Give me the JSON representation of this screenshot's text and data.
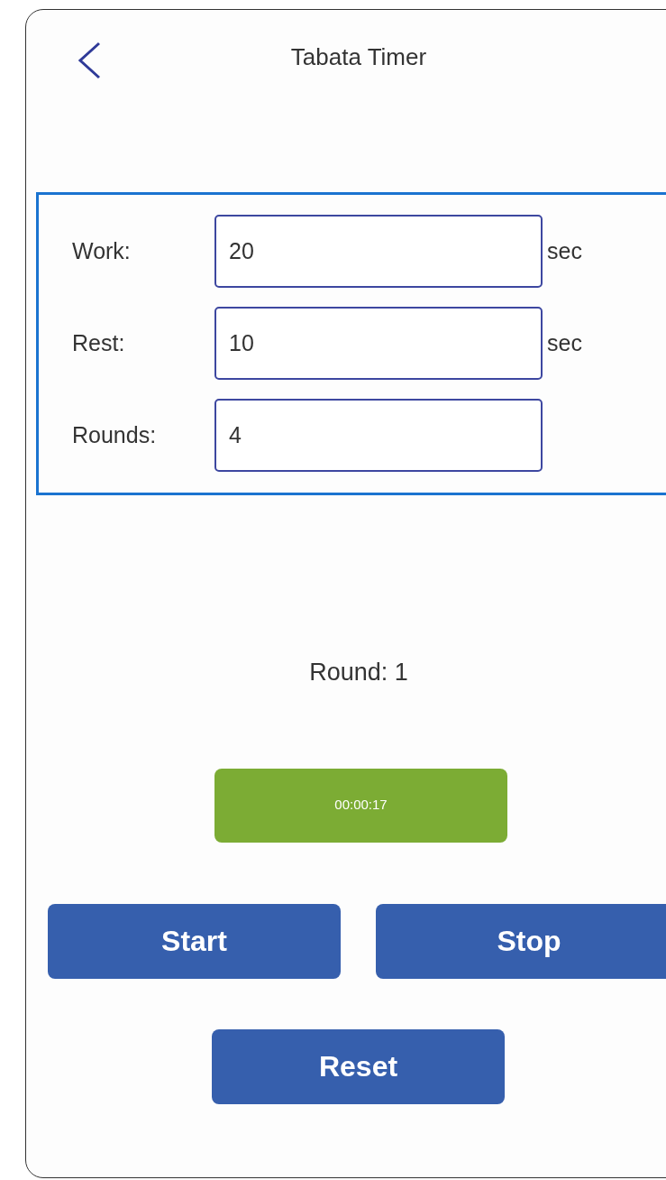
{
  "header": {
    "title": "Tabata Timer"
  },
  "settings": [
    {
      "label": "Work:",
      "value": "20",
      "unit": "sec"
    },
    {
      "label": "Rest:",
      "value": "10",
      "unit": "sec"
    },
    {
      "label": "Rounds:",
      "value": "4"
    }
  ],
  "round_label": "Round: 1",
  "timer": {
    "time": "00:00:17"
  },
  "buttons": [
    "Start",
    "Stop",
    "Reset"
  ]
}
